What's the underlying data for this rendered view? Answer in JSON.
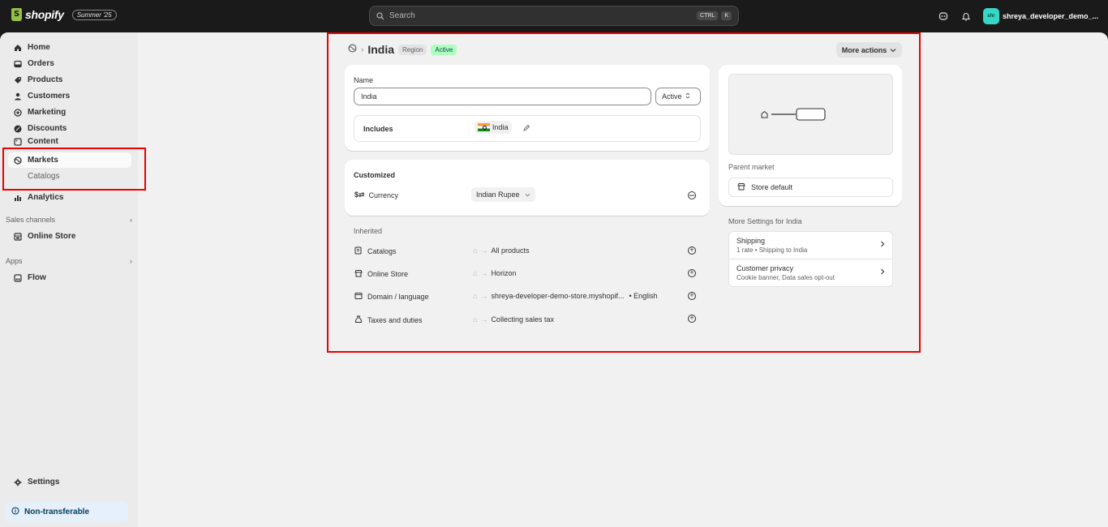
{
  "topbar": {
    "brand": "shopify",
    "edition_badge": "Summer '25",
    "search_placeholder": "Search",
    "shortcut_keys": [
      "CTRL",
      "K"
    ],
    "avatar_initials": "shr",
    "account_name": "shreya_developer_demo_..."
  },
  "sidebar": {
    "items": [
      {
        "label": "Home",
        "icon": "home-icon"
      },
      {
        "label": "Orders",
        "icon": "inbox-icon"
      },
      {
        "label": "Products",
        "icon": "tag-icon"
      },
      {
        "label": "Customers",
        "icon": "person-icon"
      },
      {
        "label": "Marketing",
        "icon": "target-icon"
      },
      {
        "label": "Discounts",
        "icon": "discount-icon"
      },
      {
        "label": "Content",
        "icon": "content-icon"
      },
      {
        "label": "Markets",
        "icon": "globe-icon"
      },
      {
        "label": "Catalogs",
        "icon": ""
      },
      {
        "label": "Analytics",
        "icon": "bar-chart-icon"
      }
    ],
    "sales_channels_label": "Sales channels",
    "online_store": "Online Store",
    "apps_label": "Apps",
    "flow": "Flow",
    "settings": "Settings",
    "non_transferable": "Non-transferable"
  },
  "page": {
    "title": "India",
    "region_badge": "Region",
    "status_badge": "Active",
    "more_actions": "More actions"
  },
  "name_card": {
    "name_label": "Name",
    "name_value": "India",
    "status_value": "Active",
    "includes_label": "Includes",
    "includes_chip": "India"
  },
  "customized": {
    "title": "Customized",
    "currency_label": "Currency",
    "currency_value": "Indian Rupee"
  },
  "inherited": {
    "title": "Inherited",
    "rows": [
      {
        "label": "Catalogs",
        "value": "All products"
      },
      {
        "label": "Online Store",
        "value": "Horizon"
      },
      {
        "label": "Domain / language",
        "value": "shreya-developer-demo-store.myshopif...",
        "extra": "• English"
      },
      {
        "label": "Taxes and duties",
        "value": "Collecting sales tax"
      }
    ]
  },
  "parent": {
    "label": "Parent market",
    "value": "Store default"
  },
  "more_settings": {
    "title": "More Settings for India",
    "items": [
      {
        "title": "Shipping",
        "subtitle": "1 rate • Shipping to India"
      },
      {
        "title": "Customer privacy",
        "subtitle": "Cookie banner, Data sales opt-out"
      }
    ]
  }
}
